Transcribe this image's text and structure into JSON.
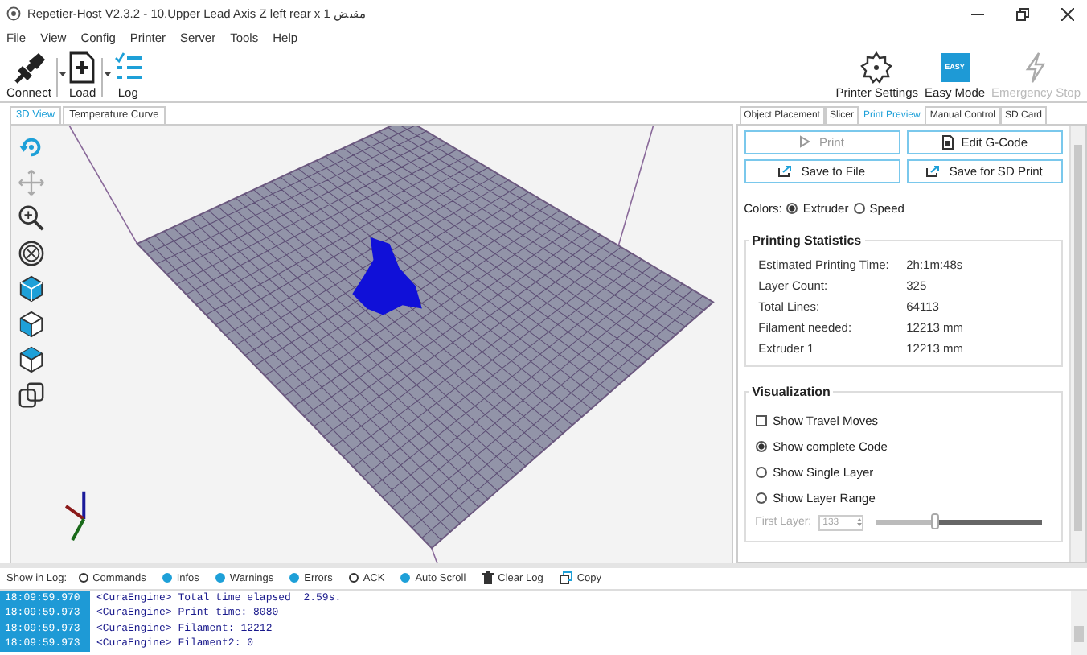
{
  "window": {
    "title": "Repetier-Host V2.3.2 - 10.Upper Lead Axis Z left rear x 1 مقبض"
  },
  "menu": [
    "File",
    "View",
    "Config",
    "Printer",
    "Server",
    "Tools",
    "Help"
  ],
  "toolbar": {
    "left": [
      {
        "label": "Connect",
        "kind": "connect",
        "dropdown": true
      },
      {
        "label": "Load",
        "kind": "load",
        "dropdown": true
      },
      {
        "label": "Log",
        "kind": "log",
        "dropdown": false
      }
    ],
    "right": [
      {
        "label": "Printer Settings",
        "kind": "settings",
        "disabled": false
      },
      {
        "label": "Easy Mode",
        "kind": "easy",
        "badge": "EASY",
        "disabled": false
      },
      {
        "label": "Emergency Stop",
        "kind": "stop",
        "disabled": true
      }
    ]
  },
  "view_tabs": [
    {
      "label": "3D View",
      "selected": true
    },
    {
      "label": "Temperature Curve",
      "selected": false
    }
  ],
  "panel_tabs": [
    {
      "label": "Object Placement",
      "selected": false
    },
    {
      "label": "Slicer",
      "selected": false
    },
    {
      "label": "Print Preview",
      "selected": true
    },
    {
      "label": "Manual Control",
      "selected": false
    },
    {
      "label": "SD Card",
      "selected": false
    }
  ],
  "preview": {
    "buttons": [
      {
        "label": "Print",
        "kind": "play",
        "disabled": true
      },
      {
        "label": "Edit G-Code",
        "kind": "doc",
        "disabled": false
      },
      {
        "label": "Save to File",
        "kind": "export",
        "disabled": false
      },
      {
        "label": "Save for SD Print",
        "kind": "export",
        "disabled": false
      }
    ],
    "colors": {
      "label": "Colors:",
      "options": [
        {
          "label": "Extruder",
          "selected": true
        },
        {
          "label": "Speed",
          "selected": false
        }
      ]
    },
    "statistics": {
      "title": "Printing Statistics",
      "rows": [
        {
          "label": "Estimated Printing Time:",
          "value": "2h:1m:48s"
        },
        {
          "label": "Layer Count:",
          "value": "325"
        },
        {
          "label": "Total Lines:",
          "value": "64113"
        },
        {
          "label": "Filament needed:",
          "value": "12213 mm"
        },
        {
          "label": "Extruder 1",
          "value": "12213 mm"
        }
      ]
    },
    "visualization": {
      "title": "Visualization",
      "options": [
        {
          "kind": "checkbox",
          "label": "Show Travel Moves",
          "checked": false
        },
        {
          "kind": "radio",
          "label": "Show complete Code",
          "selected": true
        },
        {
          "kind": "radio",
          "label": "Show Single Layer",
          "selected": false
        },
        {
          "kind": "radio",
          "label": "Show Layer Range",
          "selected": false
        }
      ],
      "first_layer": {
        "label": "First Layer:",
        "value": "133",
        "disabled": true,
        "level": 0.35
      }
    }
  },
  "log": {
    "label": "Show in Log:",
    "filters": [
      {
        "label": "Commands",
        "checked": false
      },
      {
        "label": "Infos",
        "checked": true
      },
      {
        "label": "Warnings",
        "checked": true
      },
      {
        "label": "Errors",
        "checked": true
      },
      {
        "label": "ACK",
        "checked": false
      },
      {
        "label": "Auto Scroll",
        "checked": true
      }
    ],
    "actions": [
      {
        "label": "Clear Log",
        "kind": "trash"
      },
      {
        "label": "Copy",
        "kind": "copy"
      }
    ],
    "lines": [
      {
        "time": "18:09:59.970",
        "text": "<CuraEngine> Total time elapsed  2.59s."
      },
      {
        "time": "18:09:59.973",
        "text": "<CuraEngine> Print time: 8080"
      },
      {
        "time": "18:09:59.973",
        "text": "<CuraEngine> Filament: 12212"
      },
      {
        "time": "18:09:59.973",
        "text": "<CuraEngine> Filament2: 0"
      }
    ]
  }
}
